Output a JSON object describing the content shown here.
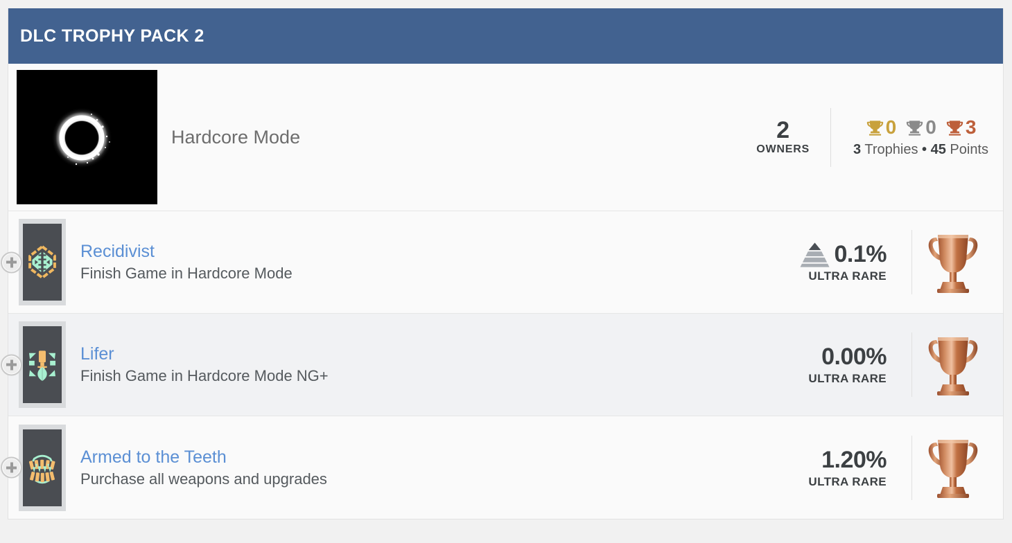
{
  "header": {
    "title": "DLC TROPHY PACK 2"
  },
  "dlc": {
    "artwork_name": "eclipse-artwork",
    "title": "Hardcore Mode",
    "owners_count": "2",
    "owners_label": "OWNERS",
    "gold_count": "0",
    "silver_count": "0",
    "bronze_count": "3",
    "trophies_count": "3",
    "trophies_word": "Trophies",
    "separator": "•",
    "points_count": "45",
    "points_word": "Points",
    "colors": {
      "gold": "#c8a13c",
      "silver": "#8a8a8a",
      "bronze": "#bd5f3a",
      "header_bg": "#426290",
      "link": "#5b8fd4"
    }
  },
  "trophies": [
    {
      "icon_name": "recidivist-trophy-icon",
      "name": "Recidivist",
      "description": "Finish Game in Hardcore Mode",
      "percent": "0.1%",
      "rarity_label": "ULTRA RARE",
      "has_pyramid_icon": true,
      "trophy_type": "bronze",
      "expand_label": "+"
    },
    {
      "icon_name": "lifer-trophy-icon",
      "name": "Lifer",
      "description": "Finish Game in Hardcore Mode NG+",
      "percent": "0.00%",
      "rarity_label": "ULTRA RARE",
      "has_pyramid_icon": false,
      "trophy_type": "bronze",
      "expand_label": "+"
    },
    {
      "icon_name": "armed-to-the-teeth-trophy-icon",
      "name": "Armed to the Teeth",
      "description": "Purchase all weapons and upgrades",
      "percent": "1.20%",
      "rarity_label": "ULTRA RARE",
      "has_pyramid_icon": false,
      "trophy_type": "bronze",
      "expand_label": "+"
    }
  ]
}
